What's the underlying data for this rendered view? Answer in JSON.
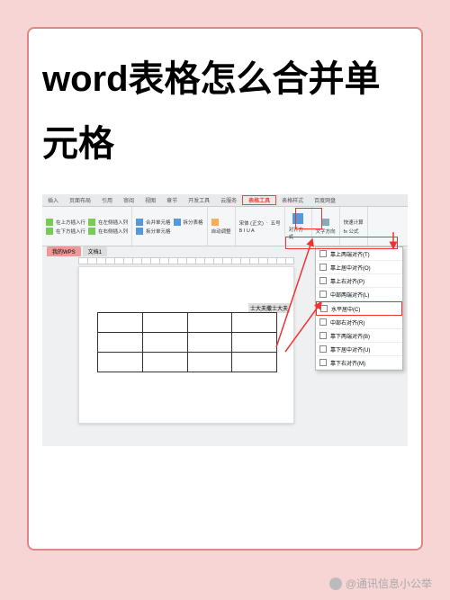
{
  "title": "word表格怎么合并单元格",
  "tabs": [
    "插入",
    "页面布局",
    "引用",
    "审阅",
    "视图",
    "章节",
    "开发工具",
    "云服务",
    "表格工具",
    "表格样式",
    "百度网盘"
  ],
  "highlight_tab_index": 8,
  "ribbon": {
    "g1": {
      "l1": "在上方插入行",
      "l2": "在下方插入行",
      "r1": "在左侧插入列",
      "r2": "在右侧插入列"
    },
    "g2": {
      "l1": "合并单元格",
      "l2": "拆分单元格",
      "r1": "拆分表格",
      "r2": ""
    },
    "g3": {
      "l": "自动调整"
    },
    "g4": {
      "font": "宋体 (正文)",
      "size": "五号",
      "btns": "B I U A"
    },
    "g5": {
      "l": "对齐方式"
    },
    "g6": {
      "l": "文字方向"
    },
    "g7": {
      "l": "快速计算",
      "r": "fx 公式"
    }
  },
  "dropdown": [
    "靠上两端对齐(T)",
    "靠上居中对齐(O)",
    "靠上右对齐(P)",
    "中部两端对齐(L)",
    "水平居中(C)",
    "中部右对齐(R)",
    "靠下两端对齐(B)",
    "靠下居中对齐(U)",
    "靠下右对齐(M)"
  ],
  "dropdown_highlight_index": 4,
  "doc_tabs": [
    "我的WPS",
    "文档1"
  ],
  "cell_text": "士大夫撒士大夫",
  "watermark": "@通讯信息小公举"
}
